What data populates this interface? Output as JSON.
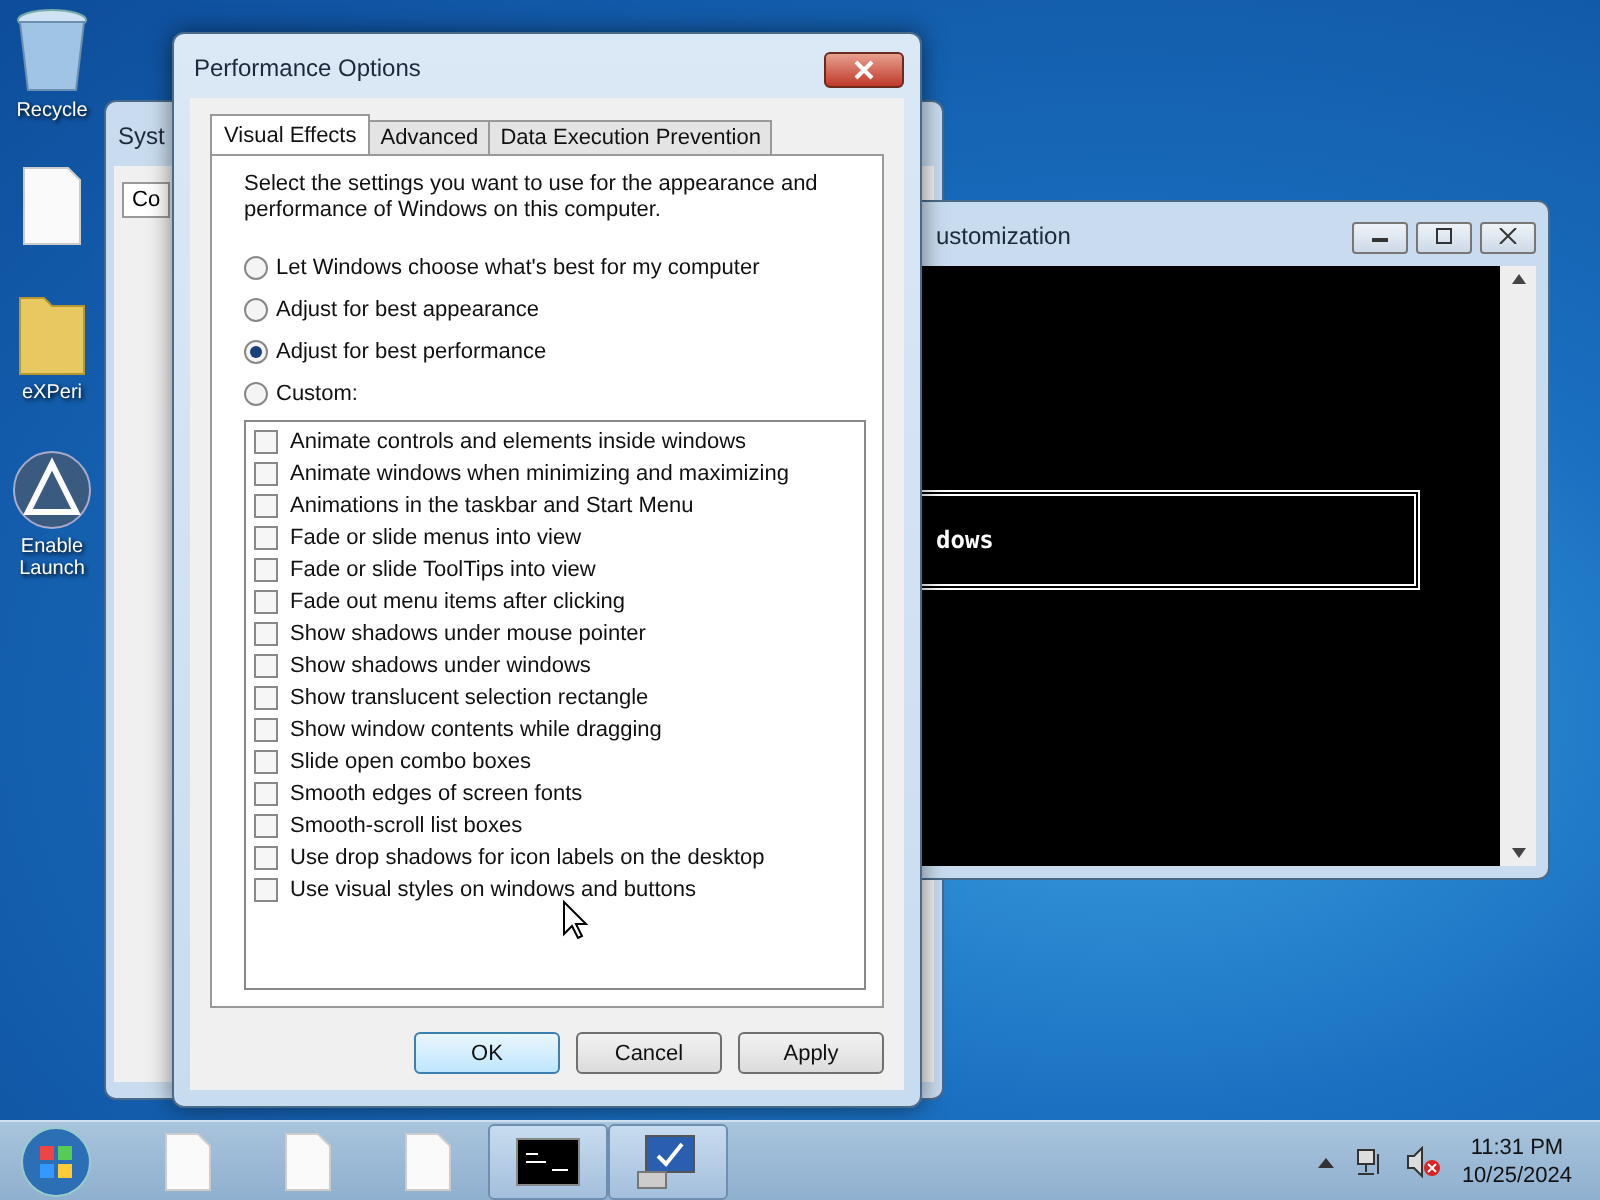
{
  "desktop_icons": [
    {
      "kind": "recycle",
      "label": "Recycle"
    },
    {
      "kind": "document"
    },
    {
      "kind": "folder",
      "label": "eXPeri"
    },
    {
      "kind": "launcher",
      "label": "Enable\nLaunch"
    }
  ],
  "back_window": {
    "title": "Syst",
    "tab": "Co"
  },
  "console_window": {
    "title": "ustomization",
    "text": "dows"
  },
  "dialog": {
    "title": "Performance Options",
    "tabs": [
      {
        "label": "Visual Effects",
        "selected": true
      },
      {
        "label": "Advanced",
        "selected": false
      },
      {
        "label": "Data Execution Prevention",
        "selected": false
      }
    ],
    "description": "Select the settings you want to use for the appearance and performance of Windows on this computer.",
    "radios": [
      {
        "label": "Let Windows choose what's best for my computer",
        "selected": false
      },
      {
        "label": "Adjust for best appearance",
        "selected": false
      },
      {
        "label": "Adjust for best performance",
        "selected": true
      },
      {
        "label": "Custom:",
        "selected": false
      }
    ],
    "options": [
      {
        "label": "Animate controls and elements inside windows",
        "checked": false
      },
      {
        "label": "Animate windows when minimizing and maximizing",
        "checked": false
      },
      {
        "label": "Animations in the taskbar and Start Menu",
        "checked": false
      },
      {
        "label": "Fade or slide menus into view",
        "checked": false
      },
      {
        "label": "Fade or slide ToolTips into view",
        "checked": false
      },
      {
        "label": "Fade out menu items after clicking",
        "checked": false
      },
      {
        "label": "Show shadows under mouse pointer",
        "checked": false
      },
      {
        "label": "Show shadows under windows",
        "checked": false
      },
      {
        "label": "Show translucent selection rectangle",
        "checked": false
      },
      {
        "label": "Show window contents while dragging",
        "checked": false
      },
      {
        "label": "Slide open combo boxes",
        "checked": false
      },
      {
        "label": "Smooth edges of screen fonts",
        "checked": false
      },
      {
        "label": "Smooth-scroll list boxes",
        "checked": false
      },
      {
        "label": "Use drop shadows for icon labels on the desktop",
        "checked": false
      },
      {
        "label": "Use visual styles on windows and buttons",
        "checked": false
      }
    ],
    "buttons": [
      {
        "label": "OK",
        "default": true
      },
      {
        "label": "Cancel",
        "default": false
      },
      {
        "label": "Apply",
        "default": false
      }
    ]
  },
  "taskbar": {
    "items": [
      {
        "kind": "document",
        "running": false
      },
      {
        "kind": "document",
        "running": false
      },
      {
        "kind": "document",
        "running": false
      },
      {
        "kind": "console",
        "running": true
      },
      {
        "kind": "monitor",
        "running": true
      }
    ],
    "time": "11:31 PM",
    "date": "10/25/2024"
  }
}
